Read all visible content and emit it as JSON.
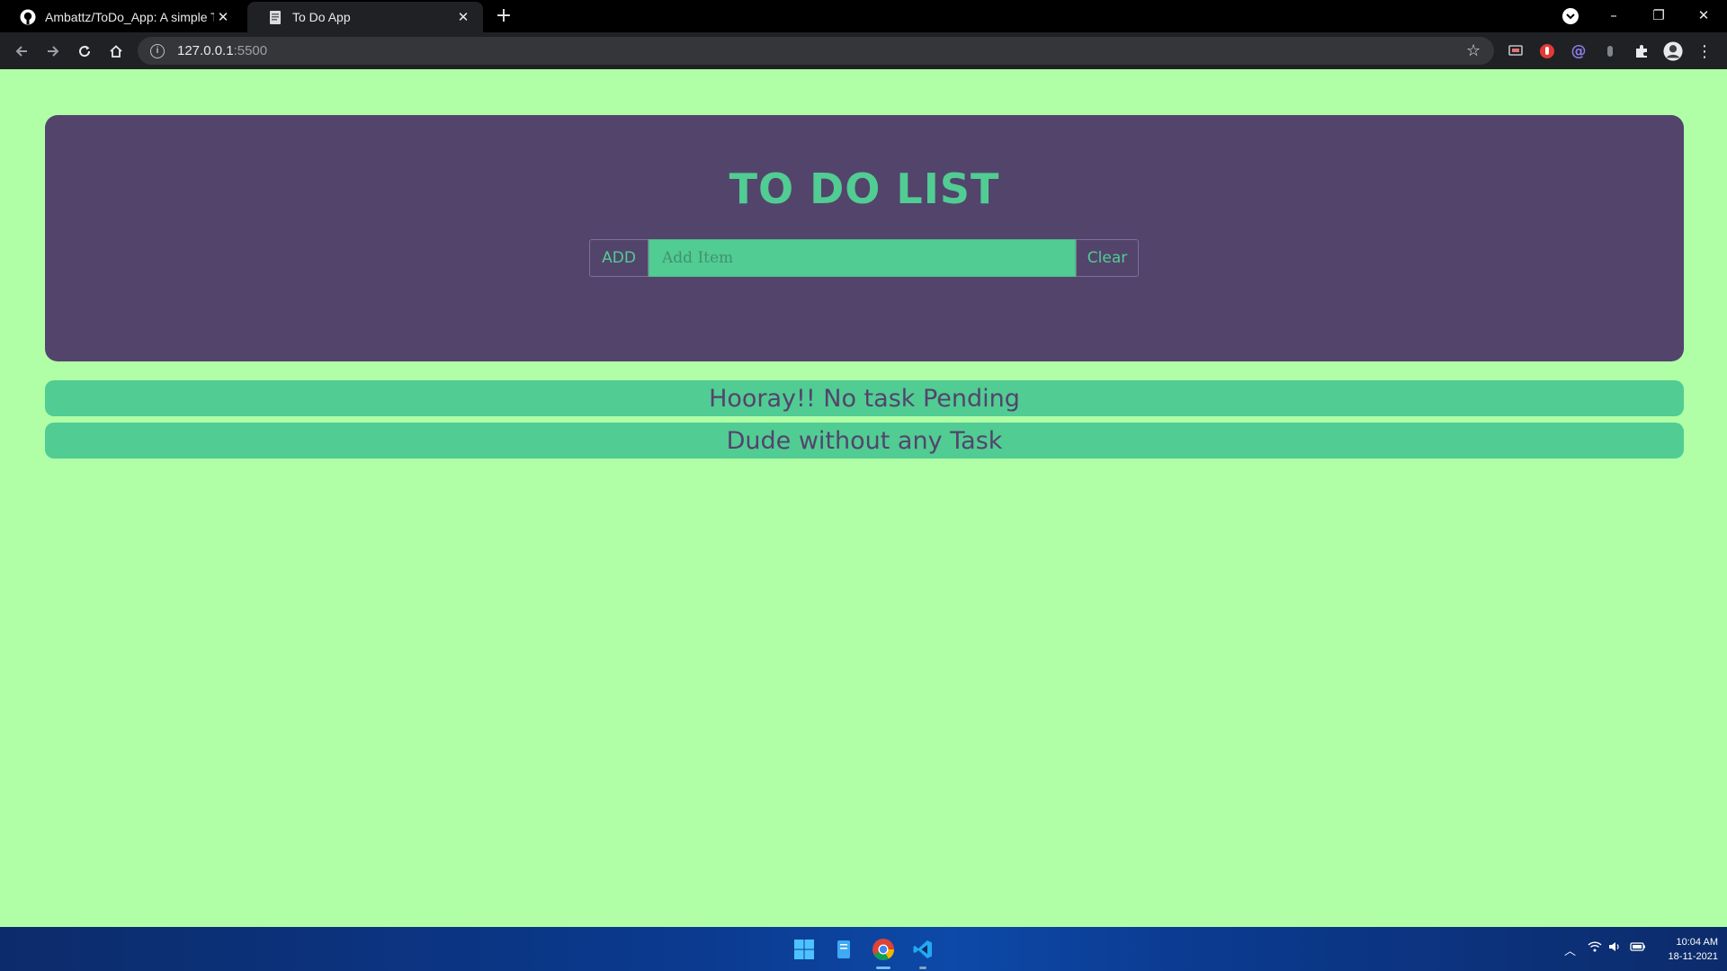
{
  "browser": {
    "tabs": [
      {
        "title": "Ambattz/ToDo_App: A simple TO",
        "icon": "github-icon"
      },
      {
        "title": "To Do App",
        "icon": "document-icon"
      }
    ],
    "address": {
      "host": "127.0.0.1",
      "port": ":5500"
    }
  },
  "app": {
    "heading": "TO DO LIST",
    "add_label": "ADD",
    "input_placeholder": "Add Item",
    "clear_label": "Clear",
    "items": [
      "Hooray!! No task Pending",
      "Dude without any Task"
    ],
    "colors": {
      "background": "#b0ffa7",
      "card": "#53446c",
      "accent": "#51cc93"
    }
  },
  "taskbar": {
    "time": "10:04 AM",
    "date": "18-11-2021"
  }
}
